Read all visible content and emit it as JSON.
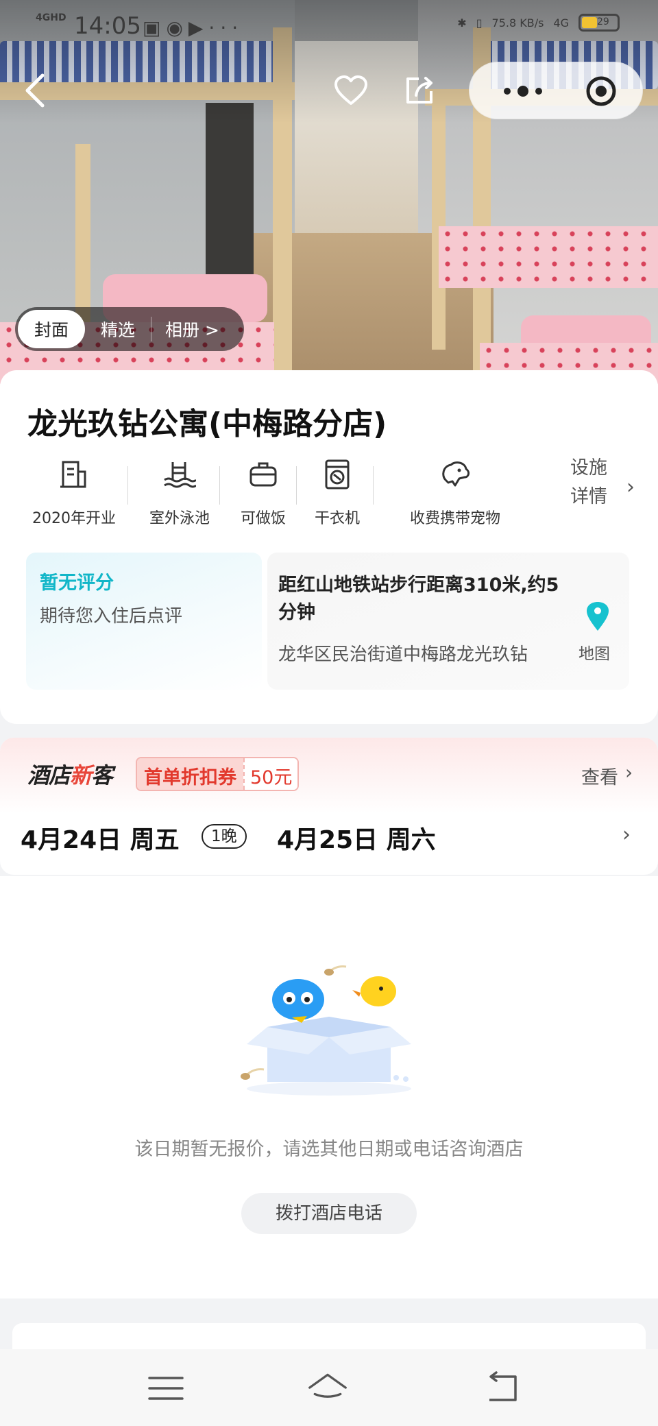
{
  "status_bar": {
    "network": "4GHD",
    "time": "14:05",
    "speed": "75.8 KB/s",
    "network_right": "4G",
    "battery": "29"
  },
  "photo_tabs": [
    "封面",
    "精选",
    "相册 >"
  ],
  "hotel": {
    "name": "龙光玖钻公寓(中梅路分店)"
  },
  "facilities": [
    {
      "label": "2020年开业",
      "icon": "building-icon"
    },
    {
      "label": "室外泳池",
      "icon": "pool-icon"
    },
    {
      "label": "可做饭",
      "icon": "cooking-pot-icon"
    },
    {
      "label": "干衣机",
      "icon": "dryer-icon"
    },
    {
      "label": "收费携带宠物",
      "icon": "pet-icon"
    }
  ],
  "facility_detail": {
    "line1": "设施",
    "line2": "详情"
  },
  "rating": {
    "title": "暂无评分",
    "subtitle": "期待您入住后点评"
  },
  "location": {
    "title": "距红山地铁站步行距离310米,约5分钟",
    "address": "龙华区民治街道中梅路龙光玖钻",
    "map_label": "地图"
  },
  "promo": {
    "brand_a": "酒店",
    "brand_x": "新",
    "brand_b": "客",
    "coupon_label": "首单折扣券",
    "coupon_value": "50元",
    "see_label": "查看"
  },
  "dates": {
    "check_in": "4月24日 周五",
    "nights": "1晚",
    "check_out": "4月25日 周六"
  },
  "empty_state": {
    "message": "该日期暂无报价，请选其他日期或电话咨询酒店",
    "button": "拨打酒店电话"
  },
  "colors": {
    "accent_teal": "#11b6c8",
    "promo_red": "#e2392d"
  }
}
